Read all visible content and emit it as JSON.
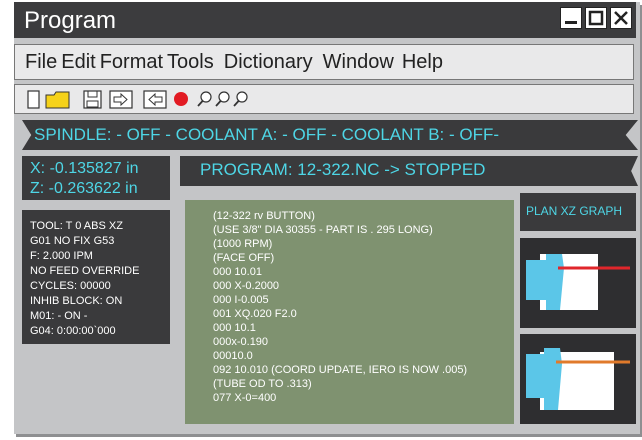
{
  "window": {
    "title": "Program"
  },
  "menu": {
    "items": [
      "File",
      "Edit",
      "Format",
      "Tools",
      "Dictionary",
      "Window",
      "Help"
    ]
  },
  "toolbar": {
    "icons": [
      "new-document-icon",
      "open-folder-icon",
      "save-icon",
      "forward-icon",
      "back-icon",
      "record-icon",
      "zoom-out-icon",
      "zoom-icon",
      "zoom-in-icon"
    ],
    "record_color": "#e21b23"
  },
  "status": {
    "text": "SPINDLE: - OFF -   COOLANT A:   - OFF -   COOLANT B:  - OFF-"
  },
  "coords": {
    "x": "X: -0.135827 in",
    "z": "Z: -0.263622 in"
  },
  "program": {
    "status": "PROGRAM: 12-322.NC -> STOPPED"
  },
  "info": {
    "lines": [
      "TOOL: T 0 ABS XZ",
      "G01 NO FIX G53",
      "F: 2.000 IPM",
      "NO FEED OVERRIDE",
      "CYCLES: 00000",
      "INHIB BLOCK: ON",
      "M01: - ON -",
      "G04: 0:00:00`000"
    ]
  },
  "code": {
    "lines": [
      "(12-322 rv BUTTON)",
      "(USE 3/8\" DIA 30355 - PART IS . 295 LONG)",
      "(1000 RPM)",
      "(FACE OFF)",
      "000 10.01",
      "000 X-0.2000",
      "000 I-0.005",
      "001 XQ.020 F2.0",
      "000 10.1",
      "000x-0.190",
      "00010.0",
      "092 10.010 (COORD UPDATE, IERO IS NOW .005)",
      "(TUBE OD TO .313)",
      "077 X-0=400"
    ]
  },
  "plan": {
    "label": "PLAN XZ GRAPH"
  },
  "graphs": {
    "line_colors": [
      "#e0262b",
      "#e07a2b"
    ],
    "part_color": "#5bc6e8"
  },
  "colors": {
    "accent": "#4ed6e6",
    "panel": "#3a3a3c",
    "code_bg": "#7f9270"
  }
}
